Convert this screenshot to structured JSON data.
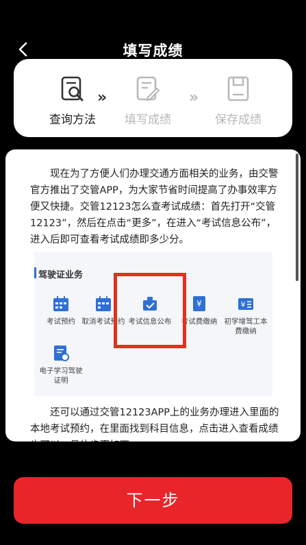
{
  "header": {
    "title": "填写成绩"
  },
  "steps": [
    {
      "label": "查询方法",
      "icon": "search-doc-icon",
      "state": "active"
    },
    {
      "label": "填写成绩",
      "icon": "edit-doc-icon",
      "state": "inactive"
    },
    {
      "label": "保存成绩",
      "icon": "save-icon",
      "state": "inactive"
    }
  ],
  "article": {
    "paragraph1": "现在为了方便人们办理交通方面相关的业务，由交警官方推出了交管APP，为大家节省时间提高了办事效率方便又快捷。交管12123怎么查考试成绩：首先打开“交管12123”，然后在点击“更多”，在进入“考试信息公布”，进入后即可查看考试成绩即多少分。",
    "paragraph2": "还可以通过交管12123APP上的业务办理进入里面的本地考试预约，在里面找到科目信息，点击进入查看成绩也可以，具体步骤如下：",
    "screenshot": {
      "section_title": "驾驶证业务",
      "services": [
        {
          "label": "考试预约",
          "icon": "calendar-icon"
        },
        {
          "label": "取消考试预约",
          "icon": "calendar-cancel-icon"
        },
        {
          "label": "考试信息公布",
          "icon": "info-icon"
        },
        {
          "label": "考试费缴纳",
          "icon": "payment-icon"
        },
        {
          "label": "初学增驾工本费缴纳",
          "icon": "fee-icon"
        },
        {
          "label": "电子学习驾驶证明",
          "icon": "e-cert-icon"
        }
      ]
    }
  },
  "footer": {
    "next_label": "下一步"
  },
  "colors": {
    "accent": "#e8262a",
    "highlight_box": "#e3301f",
    "service_icon": "#2f6fd6"
  }
}
